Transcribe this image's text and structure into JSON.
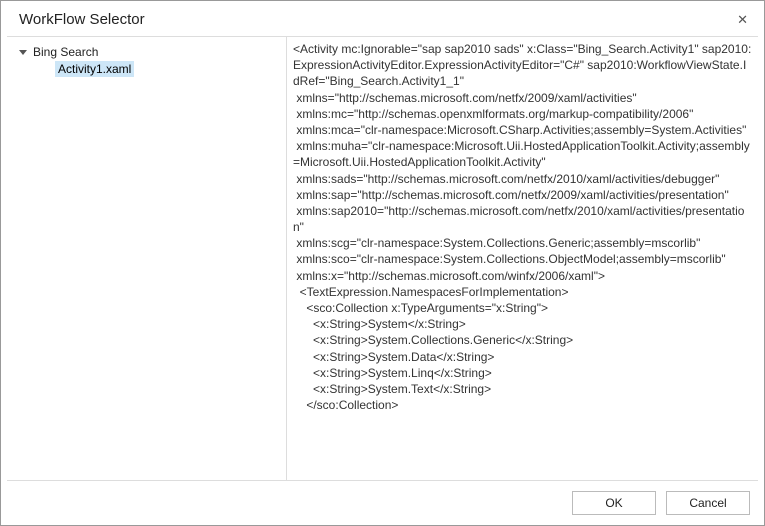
{
  "dialog": {
    "title": "WorkFlow Selector"
  },
  "tree": {
    "root": "Bing Search",
    "child": "Activity1.xaml"
  },
  "xaml": "<Activity mc:Ignorable=\"sap sap2010 sads\" x:Class=\"Bing_Search.Activity1\" sap2010:ExpressionActivityEditor.ExpressionActivityEditor=\"C#\" sap2010:WorkflowViewState.IdRef=\"Bing_Search.Activity1_1\"\n xmlns=\"http://schemas.microsoft.com/netfx/2009/xaml/activities\"\n xmlns:mc=\"http://schemas.openxmlformats.org/markup-compatibility/2006\"\n xmlns:mca=\"clr-namespace:Microsoft.CSharp.Activities;assembly=System.Activities\"\n xmlns:muha=\"clr-namespace:Microsoft.Uii.HostedApplicationToolkit.Activity;assembly=Microsoft.Uii.HostedApplicationToolkit.Activity\"\n xmlns:sads=\"http://schemas.microsoft.com/netfx/2010/xaml/activities/debugger\"\n xmlns:sap=\"http://schemas.microsoft.com/netfx/2009/xaml/activities/presentation\"\n xmlns:sap2010=\"http://schemas.microsoft.com/netfx/2010/xaml/activities/presentation\"\n xmlns:scg=\"clr-namespace:System.Collections.Generic;assembly=mscorlib\"\n xmlns:sco=\"clr-namespace:System.Collections.ObjectModel;assembly=mscorlib\"\n xmlns:x=\"http://schemas.microsoft.com/winfx/2006/xaml\">\n  <TextExpression.NamespacesForImplementation>\n    <sco:Collection x:TypeArguments=\"x:String\">\n      <x:String>System</x:String>\n      <x:String>System.Collections.Generic</x:String>\n      <x:String>System.Data</x:String>\n      <x:String>System.Linq</x:String>\n      <x:String>System.Text</x:String>\n    </sco:Collection>",
  "buttons": {
    "ok": "OK",
    "cancel": "Cancel"
  }
}
